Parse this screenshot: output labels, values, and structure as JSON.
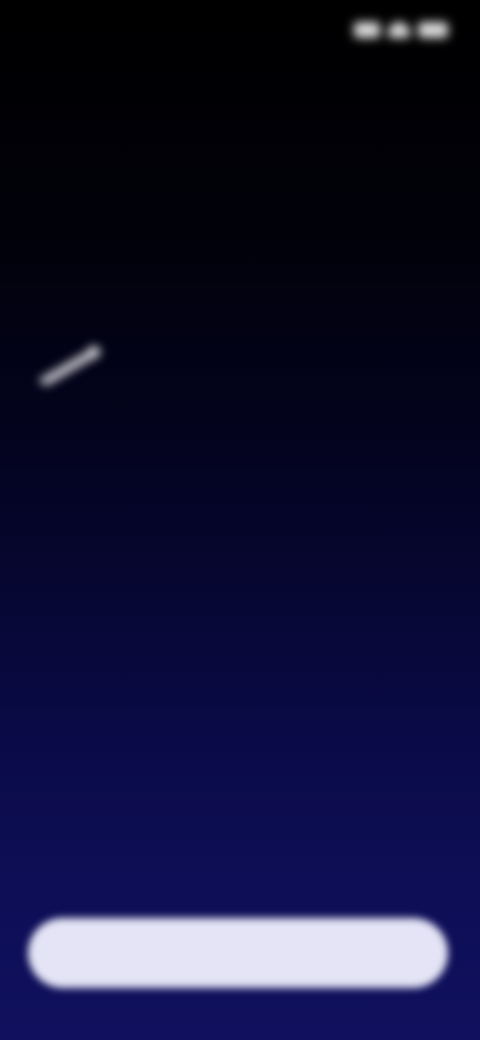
{
  "status_bar": {
    "time": "",
    "icons": [
      "signal-icon",
      "wifi-icon",
      "battery-icon"
    ]
  },
  "hero": {
    "icon": "sparkle-icon",
    "lines": [
      "",
      ""
    ]
  },
  "primary_button": {
    "label": ""
  },
  "colors": {
    "background_top": "#000000",
    "background_bottom": "#10105e",
    "button_fill": "#e4e4f6",
    "text": "#d6d6dc"
  }
}
